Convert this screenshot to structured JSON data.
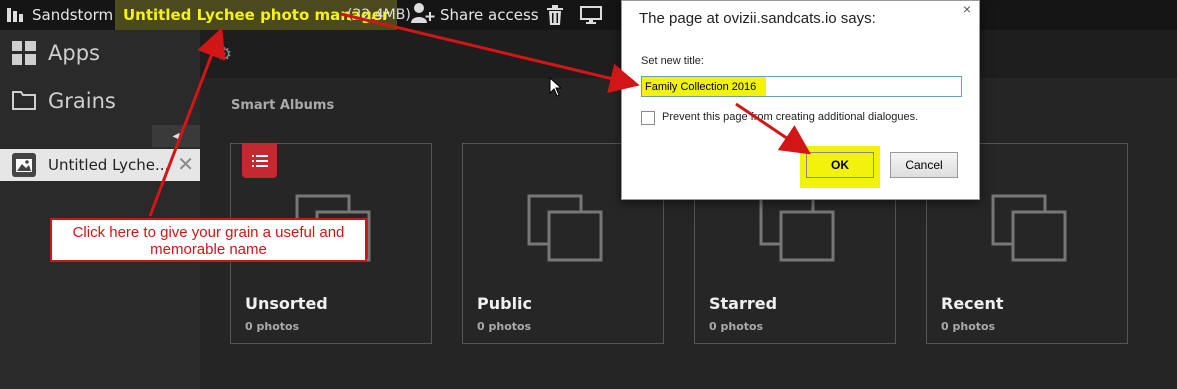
{
  "topbar": {
    "brand": "Sandstorm",
    "grain_title": "Untitled Lychee photo manager",
    "grain_size": "(22.4MB)",
    "share_label": "Share access",
    "icons": [
      "sandstorm-logo-icon",
      "share-person-icon",
      "trash-icon",
      "screen-icon"
    ]
  },
  "sidebar": {
    "apps_label": "Apps",
    "grains_label": "Grains",
    "collapse_glyph": "◂",
    "open_grain_label": "Untitled Lyche...",
    "close_glyph": "✕"
  },
  "content": {
    "gear_glyph": "⚙",
    "section_title": "Smart Albums",
    "albums": [
      {
        "name": "Unsorted",
        "count": "0 photos"
      },
      {
        "name": "Public",
        "count": "0 photos"
      },
      {
        "name": "Starred",
        "count": "0 photos"
      },
      {
        "name": "Recent",
        "count": "0 photos"
      }
    ]
  },
  "dialog": {
    "title": "The page at ovizii.sandcats.io says:",
    "close_glyph": "×",
    "prompt_label": "Set new title:",
    "input_value": "Family Collection 2016",
    "checkbox_label": "Prevent this page from creating additional dialogues.",
    "ok_label": "OK",
    "cancel_label": "Cancel"
  },
  "callout": {
    "text": "Click here to give your grain a useful and memorable name"
  },
  "colors": {
    "highlight_yellow": "#f2f20b",
    "annotation_red": "#d21515",
    "badge_red": "#c3292f"
  }
}
